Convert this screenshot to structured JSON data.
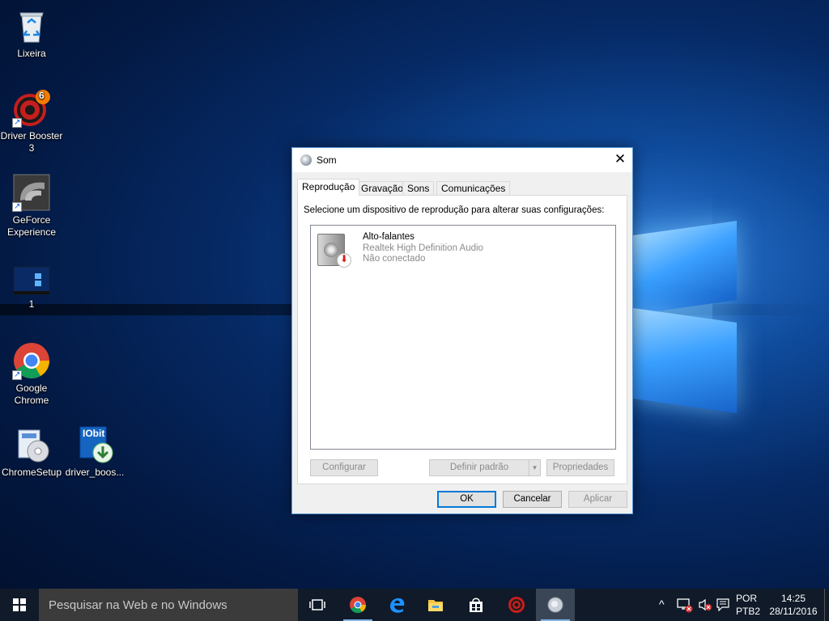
{
  "desktop": {
    "icons": [
      {
        "label_1": "Lixeira",
        "label_2": "",
        "icon": "recycle-bin-icon"
      },
      {
        "label_1": "Driver Booster",
        "label_2": "3",
        "icon": "driver-booster-icon",
        "badge": "6"
      },
      {
        "label_1": "GeForce",
        "label_2": "Experience",
        "icon": "geforce-icon"
      },
      {
        "label_1": "1",
        "label_2": "",
        "icon": "screenshot-thumbnail-icon"
      },
      {
        "label_1": "Google",
        "label_2": "Chrome",
        "icon": "chrome-icon"
      },
      {
        "label_1": "ChromeSetup",
        "label_2": "",
        "icon": "setup-installer-icon"
      },
      {
        "label_1": "driver_boos...",
        "label_2": "",
        "icon": "iobit-installer-icon",
        "brand": "IObit"
      }
    ]
  },
  "dialog": {
    "title": "Som",
    "close_glyph": "✕",
    "tabs": [
      "Reprodução",
      "Gravação",
      "Sons",
      "Comunicações"
    ],
    "active_tab": "Reprodução",
    "instruction": "Selecione um dispositivo de reprodução para alterar suas configurações:",
    "device": {
      "name": "Alto-falantes",
      "driver": "Realtek High Definition Audio",
      "status": "Não conectado"
    },
    "buttons": {
      "configure": "Configurar",
      "set_default": "Definir padrão",
      "set_default_arrow": "▼",
      "properties": "Propriedades",
      "ok": "OK",
      "cancel": "Cancelar",
      "apply": "Aplicar"
    }
  },
  "taskbar": {
    "search_placeholder": "Pesquisar na Web e no Windows",
    "language": "POR",
    "layout": "PTB2",
    "time": "14:25",
    "date": "28/11/2016",
    "tray_up_arrow": "^"
  },
  "colors": {
    "accent": "#0078d7",
    "taskbar": "#101a29",
    "search_box": "#3b3b3b"
  }
}
